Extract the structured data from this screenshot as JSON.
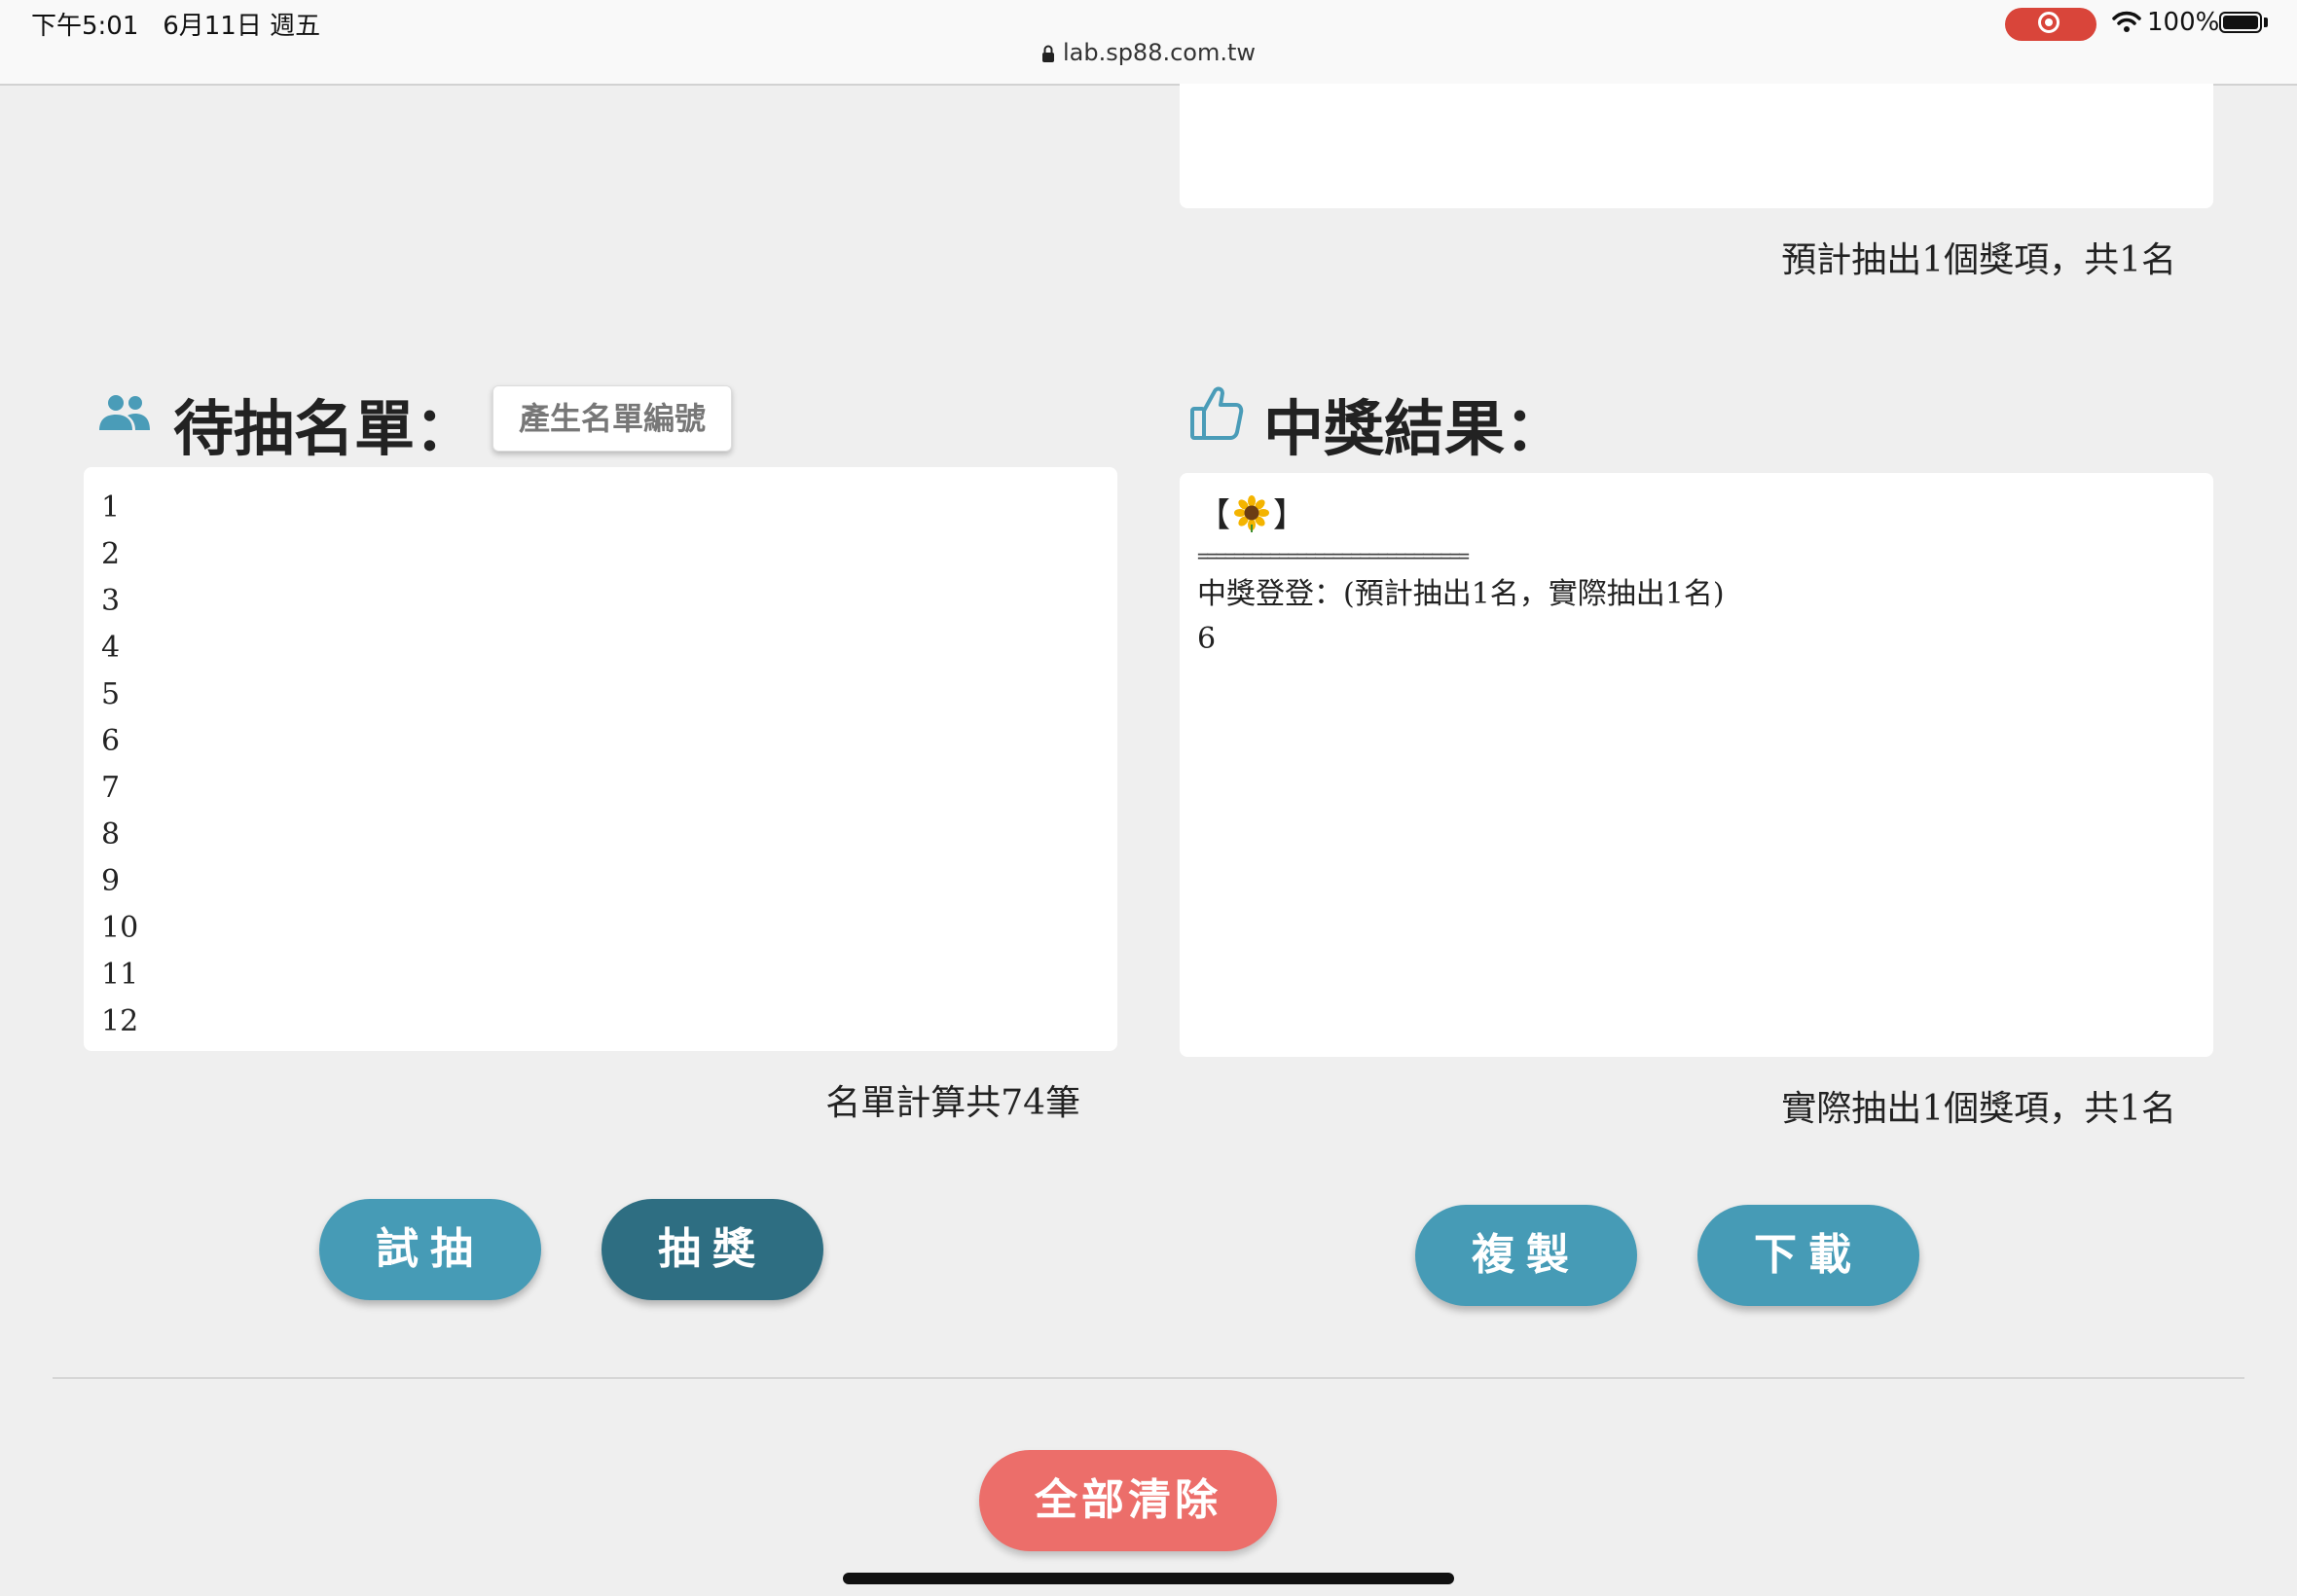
{
  "status_bar": {
    "time": "下午5:01",
    "date": "6月11日 週五",
    "url": "lab.sp88.com.tw",
    "battery_percent": "100%",
    "icons": [
      "lock-icon",
      "screen-record-icon",
      "wifi-icon",
      "battery-icon"
    ]
  },
  "prize_section": {
    "planned_text": "預計抽出1個獎項，共1名"
  },
  "list_section": {
    "title": "待抽名單：",
    "icon": "people-icon",
    "generate_button_label": "產生名單編號",
    "items": [
      "1",
      "2",
      "3",
      "4",
      "5",
      "6",
      "7",
      "8",
      "9",
      "10",
      "11",
      "12"
    ],
    "count_text": "名單計算共74筆"
  },
  "result_section": {
    "title": "中獎結果：",
    "icon": "thumbs-up-icon",
    "bracket_open": "【",
    "bracket_close": "】",
    "emoji_icon": "sunflower-icon",
    "separator": "==============================",
    "winner_line": "中獎登登：(預計抽出1名，實際抽出1名)",
    "winner": "6",
    "actual_text": "實際抽出1個獎項，共1名"
  },
  "buttons": {
    "trial": "試抽",
    "draw": "抽獎",
    "copy": "複製",
    "download": "下載",
    "clear_all": "全部清除"
  },
  "colors": {
    "teal": "#469bb6",
    "dark_teal": "#2e6e82",
    "coral": "#ec6e6a",
    "background": "#efefef"
  }
}
